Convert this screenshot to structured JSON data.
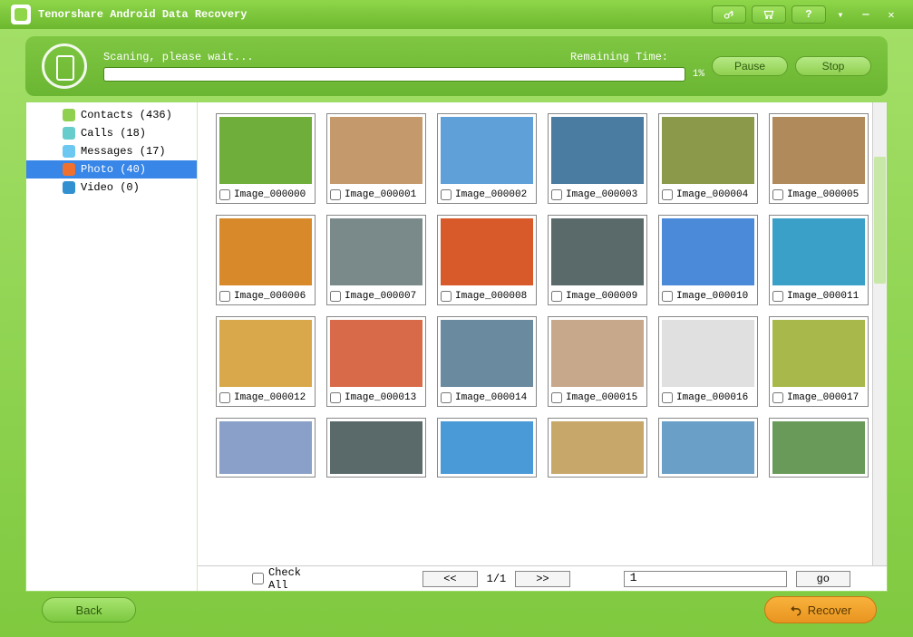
{
  "app": {
    "title": "Tenorshare Android Data Recovery"
  },
  "scan": {
    "status_label": "Scaning, please wait...",
    "remaining_label": "Remaining Time:",
    "percent": "1%",
    "pause_label": "Pause",
    "stop_label": "Stop"
  },
  "sidebar": {
    "items": [
      {
        "label": "Contacts (436)",
        "icon": "contacts"
      },
      {
        "label": "Calls (18)",
        "icon": "calls"
      },
      {
        "label": "Messages (17)",
        "icon": "messages"
      },
      {
        "label": "Photo (40)",
        "icon": "photo",
        "selected": true
      },
      {
        "label": "Video (0)",
        "icon": "video"
      }
    ]
  },
  "thumbnails": {
    "colors": [
      [
        "#6fae3a",
        "#c49a6c",
        "#5fa0d8",
        "#4a7ba0",
        "#8a9a4a",
        "#b08a5a"
      ],
      [
        "#d88a2a",
        "#7a8a8a",
        "#d85a2a",
        "#5a6a6a",
        "#4a8ad8",
        "#3aa0c8"
      ],
      [
        "#d8a84a",
        "#d86a4a",
        "#6a8aa0",
        "#c8a88a",
        "#e0e0e0",
        "#a8b84a"
      ]
    ],
    "partial_colors": [
      "#8aa0c8",
      "#5a6a6a",
      "#4a9ad8",
      "#c8a86a",
      "#6aa0c8",
      "#6a9a5a"
    ],
    "items": [
      "Image_000000",
      "Image_000001",
      "Image_000002",
      "Image_000003",
      "Image_000004",
      "Image_000005",
      "Image_000006",
      "Image_000007",
      "Image_000008",
      "Image_000009",
      "Image_000010",
      "Image_000011",
      "Image_000012",
      "Image_000013",
      "Image_000014",
      "Image_000015",
      "Image_000016",
      "Image_000017"
    ]
  },
  "pager": {
    "check_all": "Check All",
    "prev": "<<",
    "page_display": "1/1",
    "next": ">>",
    "page_input": "1",
    "go": "go"
  },
  "footer": {
    "back": "Back",
    "recover": "Recover"
  }
}
